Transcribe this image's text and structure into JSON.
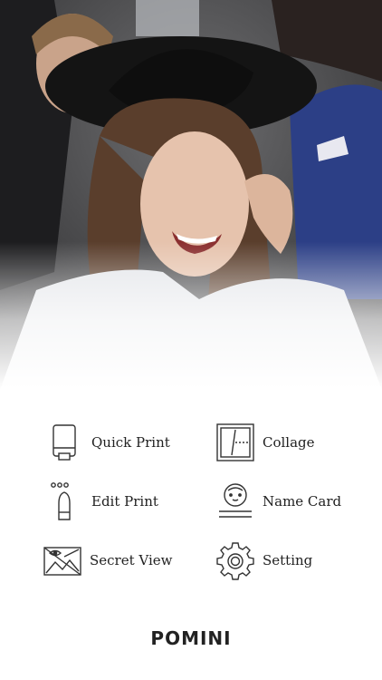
{
  "menu": {
    "items": [
      {
        "label": "Quick Print",
        "icon": "printer-icon"
      },
      {
        "label": "Collage",
        "icon": "collage-icon"
      },
      {
        "label": "Edit Print",
        "icon": "edit-pen-icon"
      },
      {
        "label": "Name Card",
        "icon": "name-card-icon"
      },
      {
        "label": "Secret View",
        "icon": "secret-view-icon"
      },
      {
        "label": "Setting",
        "icon": "gear-icon"
      }
    ]
  },
  "brand": {
    "logo_text": "POMINI"
  },
  "colors": {
    "text": "#222222",
    "background": "#ffffff",
    "icon_stroke": "#333333"
  }
}
